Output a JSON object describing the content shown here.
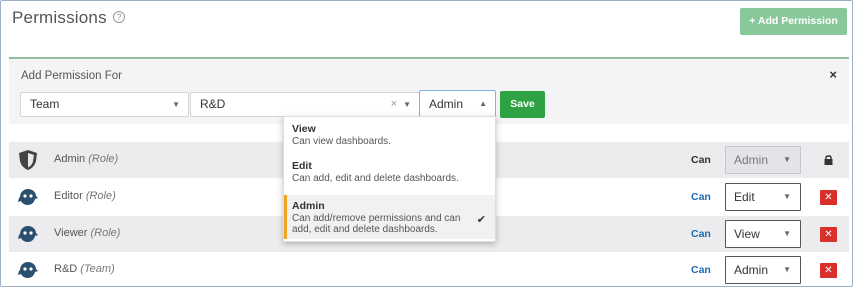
{
  "header": {
    "title": "Permissions",
    "help_icon": "?",
    "add_button": "+ Add Permission"
  },
  "add_panel": {
    "label": "Add Permission For",
    "close": "×",
    "type_value": "Team",
    "target_value": "R&D",
    "clear": "×",
    "permission_value": "Admin",
    "save_label": "Save"
  },
  "dropdown": {
    "options": [
      {
        "title": "View",
        "desc": "Can view dashboards."
      },
      {
        "title": "Edit",
        "desc": "Can add, edit and delete dashboards."
      },
      {
        "title": "Admin",
        "desc1": "Can add/remove permissions and can",
        "desc2": "add, edit and delete dashboards."
      }
    ]
  },
  "rows": [
    {
      "name": "Admin",
      "kind": "(Role)",
      "can": "Can",
      "permission": "Admin",
      "icon": "shield-icon",
      "locked": true
    },
    {
      "name": "Editor",
      "kind": "(Role)",
      "can": "Can",
      "permission": "Edit",
      "icon": "role-avatar-icon"
    },
    {
      "name": "Viewer",
      "kind": "(Role)",
      "can": "Can",
      "permission": "View",
      "icon": "role-avatar-icon"
    },
    {
      "name": "R&D",
      "kind": "(Team)",
      "can": "Can",
      "permission": "Admin",
      "icon": "team-avatar-icon"
    }
  ],
  "colors": {
    "add_button": "#88c89a",
    "save_button": "#2fa244",
    "delete_button": "#d9302c",
    "can_link": "#1a6bb0",
    "selected_accent": "#f2a31f"
  }
}
